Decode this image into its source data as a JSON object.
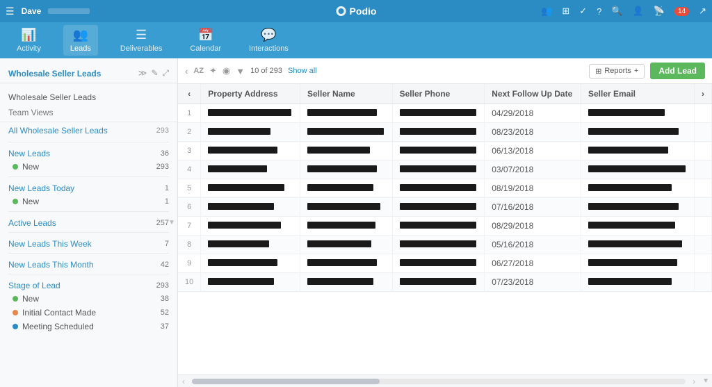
{
  "topNav": {
    "hamburger": "☰",
    "userName": "Dave",
    "appName": "Podio",
    "icons": {
      "people": "👥",
      "grid": "⊞",
      "check": "✓",
      "help": "?",
      "search": "🔍",
      "user": "👤",
      "notifications": "📡",
      "notifCount": "14",
      "share": "↗"
    }
  },
  "secondaryNav": {
    "tabs": [
      {
        "id": "activity",
        "icon": "📊",
        "label": "Activity"
      },
      {
        "id": "leads",
        "icon": "👥",
        "label": "Leads"
      },
      {
        "id": "deliverables",
        "icon": "☰",
        "label": "Deliverables"
      },
      {
        "id": "calendar",
        "icon": "📅",
        "label": "Calendar"
      },
      {
        "id": "interactions",
        "icon": "💬",
        "label": "Interactions"
      }
    ]
  },
  "sidebar": {
    "title": "Wholesale Seller Leads",
    "teamViews": "Team Views",
    "items": [
      {
        "id": "all",
        "label": "All Wholesale Seller Leads",
        "count": "293"
      },
      {
        "id": "new-leads",
        "label": "New Leads",
        "count": "36",
        "subitems": [
          {
            "label": "New",
            "count": "293",
            "dotClass": "dot-green"
          }
        ]
      },
      {
        "id": "new-leads-today",
        "label": "New Leads Today",
        "count": "1",
        "subitems": [
          {
            "label": "New",
            "count": "1",
            "dotClass": "dot-green"
          }
        ]
      },
      {
        "id": "active-leads",
        "label": "Active Leads",
        "count": "257",
        "subitems": []
      },
      {
        "id": "new-leads-week",
        "label": "New Leads This Week",
        "count": "7",
        "subitems": []
      },
      {
        "id": "new-leads-month",
        "label": "New Leads This Month",
        "count": "42",
        "subitems": []
      },
      {
        "id": "stage-of-lead",
        "label": "Stage of Lead",
        "count": "293",
        "subitems": [
          {
            "label": "New",
            "count": "38",
            "dotClass": "dot-green"
          },
          {
            "label": "Initial Contact Made",
            "count": "52",
            "dotClass": "dot-orange"
          },
          {
            "label": "Meeting Scheduled",
            "count": "37",
            "dotClass": "dot-blue"
          }
        ]
      }
    ]
  },
  "toolbar": {
    "sortIcon": "AZ",
    "settingsIcon": "✦",
    "filterIcon": "◉",
    "filterIcon2": "▼",
    "count": "10 of 293",
    "showAll": "Show all",
    "reportsLabel": "Reports",
    "addLeadLabel": "Add Lead",
    "plusIcon": "+"
  },
  "table": {
    "columns": [
      {
        "id": "num",
        "label": "#"
      },
      {
        "id": "address",
        "label": "Property Address"
      },
      {
        "id": "name",
        "label": "Seller Name"
      },
      {
        "id": "phone",
        "label": "Seller Phone"
      },
      {
        "id": "followup",
        "label": "Next Follow Up Date"
      },
      {
        "id": "email",
        "label": "Seller Email"
      }
    ],
    "rows": [
      {
        "num": "1",
        "followup": "04/29/2018",
        "addrW": 120,
        "nameW": 100,
        "phoneW": 110,
        "emailW": 110
      },
      {
        "num": "2",
        "followup": "08/23/2018",
        "addrW": 90,
        "nameW": 110,
        "phoneW": 110,
        "emailW": 130
      },
      {
        "num": "3",
        "followup": "06/13/2018",
        "addrW": 100,
        "nameW": 90,
        "phoneW": 110,
        "emailW": 115
      },
      {
        "num": "4",
        "followup": "03/07/2018",
        "addrW": 85,
        "nameW": 100,
        "phoneW": 110,
        "emailW": 140
      },
      {
        "num": "5",
        "followup": "08/19/2018",
        "addrW": 110,
        "nameW": 95,
        "phoneW": 110,
        "emailW": 120
      },
      {
        "num": "6",
        "followup": "07/16/2018",
        "addrW": 95,
        "nameW": 105,
        "phoneW": 110,
        "emailW": 130
      },
      {
        "num": "7",
        "followup": "08/29/2018",
        "addrW": 105,
        "nameW": 98,
        "phoneW": 110,
        "emailW": 125
      },
      {
        "num": "8",
        "followup": "05/16/2018",
        "addrW": 88,
        "nameW": 92,
        "phoneW": 110,
        "emailW": 135
      },
      {
        "num": "9",
        "followup": "06/27/2018",
        "addrW": 100,
        "nameW": 100,
        "phoneW": 110,
        "emailW": 128
      },
      {
        "num": "10",
        "followup": "07/23/2018",
        "addrW": 95,
        "nameW": 95,
        "phoneW": 110,
        "emailW": 120
      }
    ]
  }
}
